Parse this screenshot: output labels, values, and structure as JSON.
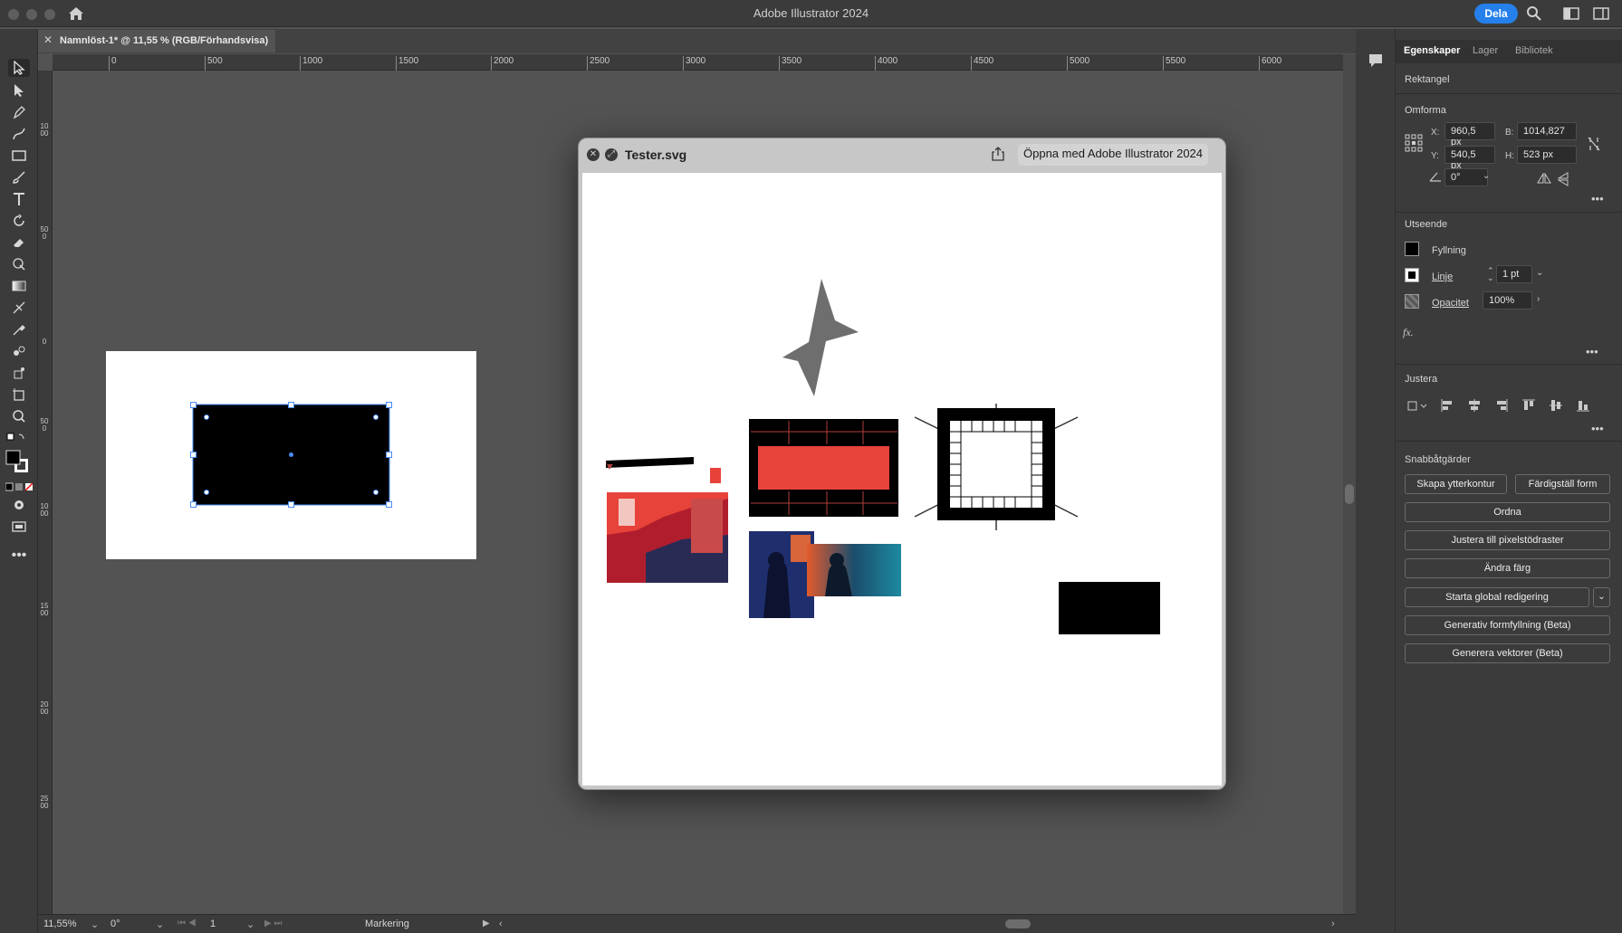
{
  "app": {
    "title": "Adobe Illustrator 2024",
    "share_label": "Dela"
  },
  "document": {
    "tab_title": "Namnlöst-1* @ 11,55 % (RGB/Förhandsvisa)"
  },
  "ruler": {
    "horizontal": [
      "0",
      "500",
      "1000",
      "1500",
      "2000",
      "2500",
      "3000",
      "3500",
      "4000",
      "4500",
      "5000",
      "5500",
      "6000"
    ],
    "vertical": [
      "1000",
      "500",
      "0",
      "500",
      "1000",
      "1500",
      "2000",
      "2500"
    ]
  },
  "quicklook": {
    "filename": "Tester.svg",
    "open_with_label": "Öppna med Adobe Illustrator 2024"
  },
  "status_bar": {
    "zoom": "11,55%",
    "rotation": "0°",
    "artboard": "1",
    "tool": "Markering"
  },
  "properties": {
    "tabs": [
      "Egenskaper",
      "Lager",
      "Bibliotek"
    ],
    "object_type": "Rektangel",
    "transform": {
      "header": "Omforma",
      "x_label": "X:",
      "x": "960,5 px",
      "y_label": "Y:",
      "y": "540,5 px",
      "w_label": "B:",
      "w": "1014,827",
      "h_label": "H:",
      "h": "523 px",
      "angle": "0°"
    },
    "appearance": {
      "header": "Utseende",
      "fill_label": "Fyllning",
      "stroke_label": "Linje",
      "stroke_weight": "1 pt",
      "opacity_label": "Opacitet",
      "opacity": "100%",
      "fx_label": "fx."
    },
    "align": {
      "header": "Justera"
    },
    "quick_actions": {
      "header": "Snabbåtgärder",
      "outline_label": "Skapa ytterkontur",
      "expand_label": "Färdigställ form",
      "arrange_label": "Ordna",
      "pixel_label": "Justera till pixelstödraster",
      "recolor_label": "Ändra färg",
      "global_edit_label": "Starta global redigering",
      "gen_fill_label": "Generativ formfyllning (Beta)",
      "gen_vector_label": "Generera vektorer (Beta)"
    }
  },
  "colors": {
    "accent": "#2680eb",
    "selection": "#4a8cf7",
    "poster_red": "#e8433a",
    "star_gray": "#6e6e6e"
  }
}
